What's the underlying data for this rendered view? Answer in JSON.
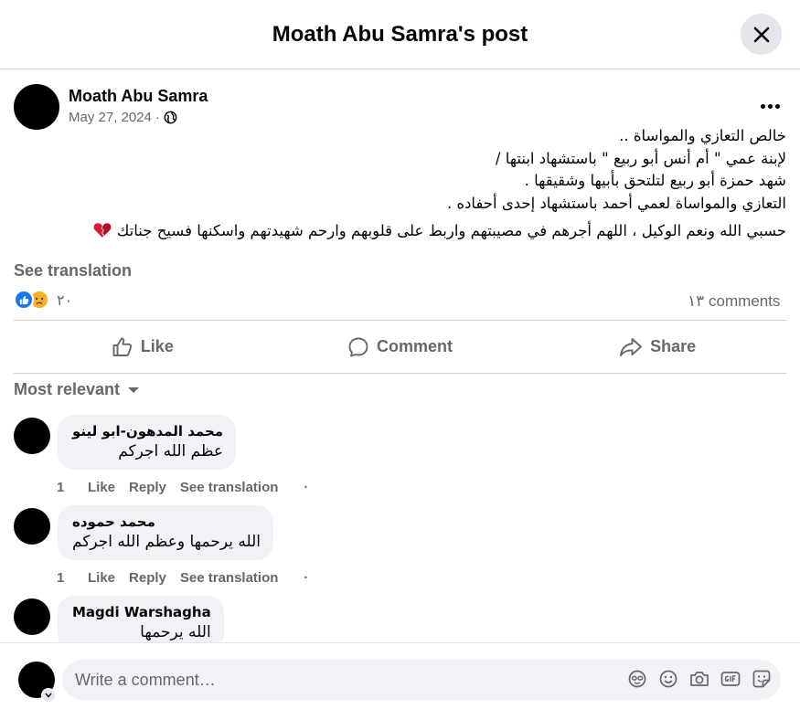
{
  "modal": {
    "title": "Moath Abu Samra's post"
  },
  "post": {
    "author": "Moath Abu Samra",
    "date": "May 27, 2024",
    "separator": "·",
    "body": {
      "line1": "خالص التعازي والمواساة ..",
      "line2": "لإبنة عمي \" أم أنس أبو ربيع \" باستشهاد ابنتها /",
      "line3": "شهد حمزة أبو ربيع لتلتحق بأبيها وشقيقها .",
      "line4": "التعازي والمواساة لعمي أحمد باستشهاد إحدى أحفاده .",
      "line5": "حسبي الله ونعم الوكيل ، اللهم أجرهم في مصيبتهم واربط على قلوبهم وارحم شهيدتهم واسكنها فسيح جناتك"
    },
    "see_translation": "See translation",
    "reaction_count": "٢٠",
    "comment_count": "١٣ comments"
  },
  "actions": {
    "like": "Like",
    "comment": "Comment",
    "share": "Share"
  },
  "sort": {
    "label": "Most relevant"
  },
  "comments": [
    {
      "name": "محمد المدهون-ابو لينو",
      "text": "عظم الله اجركم",
      "likes": "1",
      "like": "Like",
      "reply": "Reply",
      "translate": "See translation",
      "dot": "·"
    },
    {
      "name": "محمد حموده",
      "text": "الله يرحمها وعظم الله اجركم",
      "likes": "1",
      "like": "Like",
      "reply": "Reply",
      "translate": "See translation",
      "dot": "·"
    },
    {
      "name": "Magdi Warshagha",
      "text": "الله يرحمها"
    }
  ],
  "composer": {
    "placeholder": "Write a comment…"
  },
  "icons": {
    "close": "close-icon",
    "globe": "globe-icon",
    "more": "more-icon",
    "heart": "broken-heart-icon",
    "like_reaction": "like-reaction-icon",
    "sad_reaction": "sad-reaction-icon",
    "like": "thumbs-up-icon",
    "comment": "comment-bubble-icon",
    "share": "share-arrow-icon",
    "dropdown": "caret-down-icon",
    "avatar": "sticker-icon",
    "emoji": "emoji-icon",
    "camera": "camera-icon",
    "gif": "gif-icon",
    "sticker": "sticker-icon"
  },
  "colors": {
    "accent": "#1877f2",
    "secondary_text": "#65676b",
    "bubble": "#f0f2f5",
    "divider": "#ced0d4"
  }
}
